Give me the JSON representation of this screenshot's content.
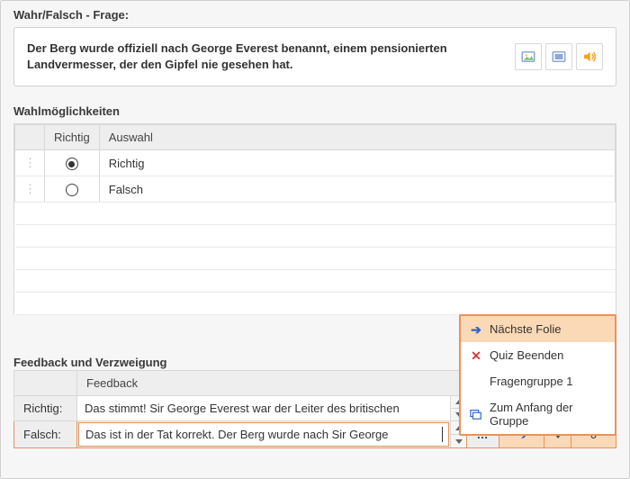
{
  "header": {
    "title": "Wahr/Falsch - Frage:"
  },
  "question": {
    "text": "Der Berg wurde offiziell nach George Everest benannt, einem pensionierten Landvermesser, der den Gipfel nie gesehen hat."
  },
  "choices": {
    "title": "Wahlmöglichkeiten",
    "col_correct": "Richtig",
    "col_choice": "Auswahl",
    "rows": [
      {
        "label": "Richtig",
        "selected": true
      },
      {
        "label": "Falsch",
        "selected": false
      }
    ]
  },
  "feedback": {
    "title": "Feedback und Verzweigung",
    "col_feedback": "Feedback",
    "rows": {
      "correct": {
        "label": "Richtig:",
        "text": "Das stimmt! Sir George Everest war der Leiter des britischen"
      },
      "wrong": {
        "label": "Falsch:",
        "text": "Das ist in der Tat korrekt. Der Berg wurde nach Sir George",
        "branch_count": "0"
      }
    }
  },
  "menu": {
    "items": [
      {
        "label": "Nächste Folie"
      },
      {
        "label": "Quiz Beenden"
      },
      {
        "label": "Fragengruppe 1"
      },
      {
        "label": "Zum Anfang der Gruppe"
      }
    ]
  }
}
